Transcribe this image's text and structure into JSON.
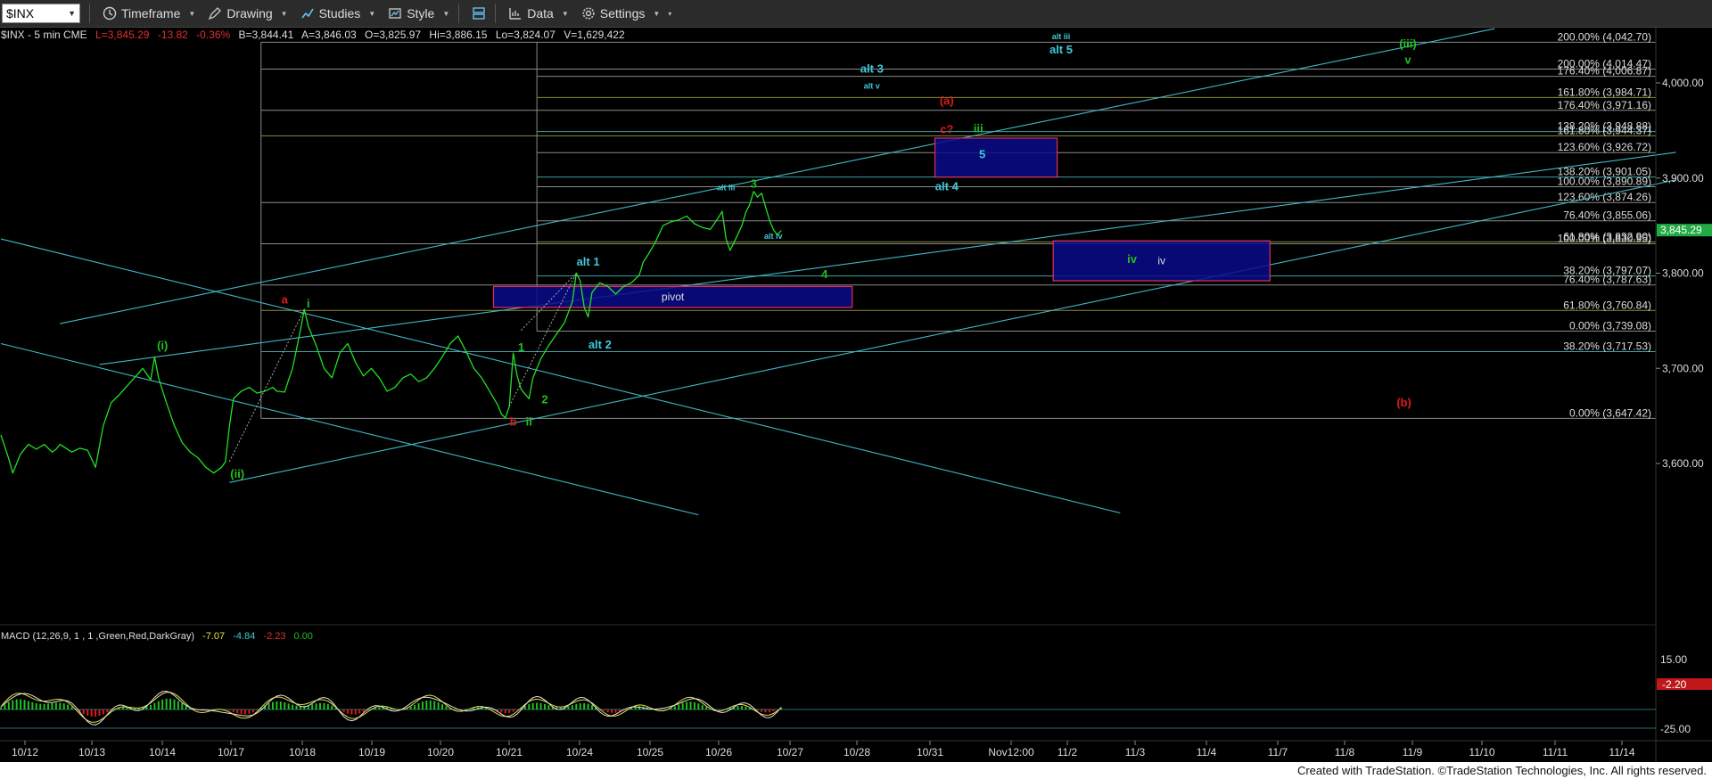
{
  "toolbar": {
    "symbol": "$INX",
    "timeframe_label": "Timeframe",
    "drawing_label": "Drawing",
    "studies_label": "Studies",
    "style_label": "Style",
    "data_label": "Data",
    "settings_label": "Settings"
  },
  "quote_bar": {
    "symbol": "$INX - 5 min  CME",
    "low": "L=3,845.29",
    "change": "-13.82",
    "change_pct": "-0.36%",
    "bid": "B=3,844.41",
    "ask": "A=3,846.03",
    "open": "O=3,825.97",
    "high": "Hi=3,886.15",
    "lo": "Lo=3,824.07",
    "volume": "V=1,629,422"
  },
  "macd": {
    "label": "MACD (12,26,9, 1 , 1 ,Green,Red,DarkGray)",
    "v1": "-7.07",
    "v2": "-4.84",
    "v3": "-2.23",
    "v4": "0.00",
    "axis_top": "15.00",
    "axis_bottom": "-25.00",
    "current": "-2.20"
  },
  "footer": "Created with TradeStation. ©TradeStation Technologies, Inc. All rights reserved.",
  "colors": {
    "price": "#22e022",
    "channel": "#3fb8c8",
    "fib_gray": "#8a8a8a",
    "fib_olive": "#8a8a3a",
    "box_fill": "#0a0a8a",
    "box_border": "#e0305a",
    "label_red": "#e01818",
    "label_green": "#20c020",
    "label_cyan": "#40c8d8",
    "price_tag": "#22aa44"
  },
  "chart_data": {
    "type": "line",
    "ylim": [
      3530,
      4060
    ],
    "y_ticks": [
      "4,000.00",
      "3,900.00",
      "3,800.00",
      "3,700.00",
      "3,600.00"
    ],
    "y_tick_values": [
      4000,
      3900,
      3800,
      3700,
      3600
    ],
    "x_labels": [
      "10/12",
      "10/13",
      "10/14",
      "10/17",
      "10/18",
      "10/19",
      "10/20",
      "10/21",
      "10/24",
      "10/25",
      "10/26",
      "10/27",
      "10/28",
      "10/31",
      "Nov12:00",
      "11/2",
      "11/3",
      "11/4",
      "11/7",
      "11/8",
      "11/9",
      "11/10",
      "11/11",
      "11/14"
    ],
    "last_price": "3,845.29",
    "last_price_value": 3845.29,
    "price_path": [
      [
        0,
        3630
      ],
      [
        2,
        3605
      ],
      [
        3,
        3590
      ],
      [
        5,
        3610
      ],
      [
        7,
        3620
      ],
      [
        9,
        3615
      ],
      [
        11,
        3620
      ],
      [
        13,
        3612
      ],
      [
        14,
        3615
      ],
      [
        15,
        3620
      ],
      [
        18,
        3612
      ],
      [
        20,
        3616
      ],
      [
        22,
        3614
      ],
      [
        24,
        3596
      ],
      [
        26,
        3640
      ],
      [
        28,
        3664
      ],
      [
        30,
        3672
      ],
      [
        33,
        3686
      ],
      [
        36,
        3700
      ],
      [
        38,
        3688
      ],
      [
        39,
        3712
      ],
      [
        40,
        3690
      ],
      [
        42,
        3664
      ],
      [
        44,
        3640
      ],
      [
        46,
        3622
      ],
      [
        48,
        3612
      ],
      [
        50,
        3606
      ],
      [
        52,
        3596
      ],
      [
        54,
        3590
      ],
      [
        56,
        3596
      ],
      [
        57,
        3602
      ],
      [
        58,
        3640
      ],
      [
        59,
        3668
      ],
      [
        61,
        3676
      ],
      [
        63,
        3680
      ],
      [
        65,
        3674
      ],
      [
        67,
        3676
      ],
      [
        69,
        3680
      ],
      [
        70,
        3676
      ],
      [
        72,
        3675
      ],
      [
        73,
        3688
      ],
      [
        74,
        3700
      ],
      [
        76,
        3740
      ],
      [
        77,
        3762
      ],
      [
        78,
        3744
      ],
      [
        80,
        3724
      ],
      [
        82,
        3700
      ],
      [
        84,
        3690
      ],
      [
        86,
        3716
      ],
      [
        88,
        3726
      ],
      [
        90,
        3706
      ],
      [
        92,
        3692
      ],
      [
        94,
        3700
      ],
      [
        96,
        3690
      ],
      [
        98,
        3676
      ],
      [
        100,
        3680
      ],
      [
        102,
        3690
      ],
      [
        104,
        3694
      ],
      [
        106,
        3686
      ],
      [
        108,
        3690
      ],
      [
        110,
        3700
      ],
      [
        112,
        3712
      ],
      [
        114,
        3726
      ],
      [
        116,
        3734
      ],
      [
        118,
        3718
      ],
      [
        120,
        3700
      ],
      [
        122,
        3690
      ],
      [
        124,
        3676
      ],
      [
        126,
        3662
      ],
      [
        127,
        3652
      ],
      [
        128,
        3648
      ],
      [
        129,
        3660
      ],
      [
        130,
        3716
      ],
      [
        131,
        3692
      ],
      [
        132,
        3678
      ],
      [
        134,
        3668
      ],
      [
        135,
        3690
      ],
      [
        137,
        3710
      ],
      [
        139,
        3724
      ],
      [
        141,
        3736
      ],
      [
        143,
        3748
      ],
      [
        145,
        3770
      ],
      [
        146,
        3800
      ],
      [
        147,
        3792
      ],
      [
        148,
        3764
      ],
      [
        149,
        3754
      ],
      [
        150,
        3780
      ],
      [
        152,
        3790
      ],
      [
        154,
        3786
      ],
      [
        156,
        3778
      ],
      [
        158,
        3786
      ],
      [
        160,
        3790
      ],
      [
        162,
        3798
      ],
      [
        163,
        3812
      ],
      [
        164,
        3818
      ],
      [
        166,
        3832
      ],
      [
        168,
        3850
      ],
      [
        170,
        3854
      ],
      [
        172,
        3856
      ],
      [
        174,
        3860
      ],
      [
        176,
        3852
      ],
      [
        178,
        3848
      ],
      [
        180,
        3846
      ],
      [
        182,
        3858
      ],
      [
        183,
        3865
      ],
      [
        184,
        3836
      ],
      [
        185,
        3824
      ],
      [
        186,
        3832
      ],
      [
        188,
        3850
      ],
      [
        189,
        3864
      ],
      [
        190,
        3872
      ],
      [
        191,
        3886
      ],
      [
        192,
        3880
      ],
      [
        193,
        3884
      ],
      [
        194,
        3870
      ],
      [
        195,
        3856
      ],
      [
        196,
        3846
      ],
      [
        197,
        3840
      ],
      [
        198,
        3845
      ]
    ],
    "fib_levels": [
      {
        "label": "200.00% (4,042.70)",
        "value": 4042.7,
        "start": 66,
        "color": "#8a8a8a"
      },
      {
        "label": "200.00% (4,014.47)",
        "value": 4014.47,
        "start": 66,
        "color": "#8a8a8a"
      },
      {
        "label": "176.40% (4,006.87)",
        "value": 4006.87,
        "start": 136,
        "color": "#8a8a8a"
      },
      {
        "label": "161.80% (3,984.71)",
        "value": 3984.71,
        "start": 136,
        "color": "#8a8a3a"
      },
      {
        "label": "176.40% (3,971.16)",
        "value": 3971.16,
        "start": 66,
        "color": "#8a8a8a"
      },
      {
        "label": "138.20% (3,948.88)",
        "value": 3948.88,
        "start": 136,
        "color": "#3fa0a0"
      },
      {
        "label": "161.80% (3,944.37)",
        "value": 3944.37,
        "start": 66,
        "color": "#8a8a3a"
      },
      {
        "label": "123.60% (3,926.72)",
        "value": 3926.72,
        "start": 136,
        "color": "#8a8a8a"
      },
      {
        "label": "138.20% (3,901.05)",
        "value": 3901.05,
        "start": 136,
        "color": "#3fa0a0"
      },
      {
        "label": "100.00% (3,890.89)",
        "value": 3890.89,
        "start": 136,
        "color": "#8a8a8a"
      },
      {
        "label": "123.60% (3,874.26)",
        "value": 3874.26,
        "start": 66,
        "color": "#8a8a8a"
      },
      {
        "label": "76.40% (3,855.06)",
        "value": 3855.06,
        "start": 136,
        "color": "#8a8a8a"
      },
      {
        "label": "61.80% (3,832.90)",
        "value": 3832.9,
        "start": 136,
        "color": "#8a8a3a"
      },
      {
        "label": "100.00% (3,830.95)",
        "value": 3830.95,
        "start": 66,
        "color": "#8a8a8a"
      },
      {
        "label": "38.20% (3,797.07)",
        "value": 3797.07,
        "start": 136,
        "color": "#3fa0a0"
      },
      {
        "label": "76.40% (3,787.63)",
        "value": 3787.63,
        "start": 66,
        "color": "#8a8a8a"
      },
      {
        "label": "61.80% (3,760.84)",
        "value": 3760.84,
        "start": 66,
        "color": "#8a8a3a"
      },
      {
        "label": "0.00% (3,739.08)",
        "value": 3739.08,
        "start": 136,
        "color": "#8a8a8a"
      },
      {
        "label": "38.20% (3,717.53)",
        "value": 3717.53,
        "start": 66,
        "color": "#3fa0a0"
      },
      {
        "label": "0.00% (3,647.42)",
        "value": 3647.42,
        "start": 66,
        "color": "#8a8a8a"
      }
    ],
    "boxes": [
      {
        "label": "pivot",
        "x0": 125,
        "x1": 216,
        "y0": 3786,
        "y1": 3764
      },
      {
        "label": "",
        "x0": 237,
        "x1": 268,
        "y0": 3942,
        "y1": 3901
      },
      {
        "label": "iv",
        "x0": 267,
        "x1": 322,
        "y0": 3834,
        "y1": 3792
      }
    ],
    "channels": [
      {
        "x0": 15,
        "y0": 3747,
        "x1": 379,
        "y1": 4057
      },
      {
        "x0": 25,
        "y0": 3704,
        "x1": 425,
        "y1": 3927
      },
      {
        "x0": 58,
        "y0": 3580,
        "x1": 425,
        "y1": 3898
      },
      {
        "x0": 0,
        "y0": 3836,
        "x1": 284,
        "y1": 3548
      },
      {
        "x0": 0,
        "y0": 3726,
        "x1": 177,
        "y1": 3546
      }
    ],
    "annotations": [
      {
        "text": "(i)",
        "x": 41,
        "y": 3720,
        "color": "#20c020"
      },
      {
        "text": "(ii)",
        "x": 60,
        "y": 3585,
        "color": "#20c020"
      },
      {
        "text": "a",
        "x": 72,
        "y": 3768,
        "color": "#e01818"
      },
      {
        "text": "i",
        "x": 78,
        "y": 3764,
        "color": "#20c020"
      },
      {
        "text": "b",
        "x": 130,
        "y": 3640,
        "color": "#e01818"
      },
      {
        "text": "ii",
        "x": 134,
        "y": 3640,
        "color": "#20c020"
      },
      {
        "text": "1",
        "x": 132,
        "y": 3718,
        "color": "#20c020"
      },
      {
        "text": "2",
        "x": 138,
        "y": 3663,
        "color": "#20c020"
      },
      {
        "text": "alt 1",
        "x": 149,
        "y": 3808,
        "color": "#40c8d8"
      },
      {
        "text": "alt 2",
        "x": 152,
        "y": 3721,
        "color": "#40c8d8"
      },
      {
        "text": "4",
        "x": 209,
        "y": 3795,
        "color": "#20c020"
      },
      {
        "text": "alt iii",
        "x": 184,
        "y": 3887,
        "color": "#40c8d8"
      },
      {
        "text": "3",
        "x": 191,
        "y": 3890,
        "color": "#20c020"
      },
      {
        "text": "alt iv",
        "x": 196,
        "y": 3836,
        "color": "#40c8d8"
      },
      {
        "text": "alt 3",
        "x": 221,
        "y": 4011,
        "color": "#40c8d8"
      },
      {
        "text": "alt v",
        "x": 221,
        "y": 3994,
        "color": "#40c8d8"
      },
      {
        "text": "(a)",
        "x": 240,
        "y": 3977,
        "color": "#e01818"
      },
      {
        "text": "c?",
        "x": 240,
        "y": 3947,
        "color": "#e01818"
      },
      {
        "text": "iii",
        "x": 248,
        "y": 3948,
        "color": "#20c020"
      },
      {
        "text": "5",
        "x": 249,
        "y": 3921,
        "color": "#40c8d8"
      },
      {
        "text": "alt 4",
        "x": 240,
        "y": 3887,
        "color": "#40c8d8"
      },
      {
        "text": "alt iii",
        "x": 269,
        "y": 4046,
        "color": "#40c8d8"
      },
      {
        "text": "alt 5",
        "x": 269,
        "y": 4031,
        "color": "#40c8d8"
      },
      {
        "text": "iv",
        "x": 287,
        "y": 3811,
        "color": "#20c020"
      },
      {
        "text": "(iii)",
        "x": 357,
        "y": 4037,
        "color": "#20c020"
      },
      {
        "text": "v",
        "x": 357,
        "y": 4020,
        "color": "#20c020"
      },
      {
        "text": "(b)",
        "x": 356,
        "y": 3660,
        "color": "#e01818"
      }
    ]
  }
}
